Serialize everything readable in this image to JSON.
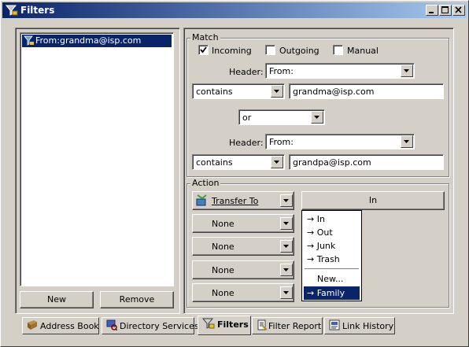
{
  "window": {
    "title": "Filters"
  },
  "filters": {
    "items": [
      {
        "label": "From:grandma@isp.com"
      }
    ]
  },
  "buttons": {
    "new": "New",
    "remove": "Remove"
  },
  "match": {
    "group_title": "Match",
    "incoming": {
      "label": "Incoming",
      "checked": true
    },
    "outgoing": {
      "label": "Outgoing",
      "checked": false
    },
    "manual": {
      "label": "Manual",
      "checked": false
    },
    "header_label": "Header:",
    "header1": "From:",
    "condition1": "contains",
    "value1": "grandma@isp.com",
    "conjunction": "or",
    "header2": "From:",
    "condition2": "contains",
    "value2": "grandpa@isp.com"
  },
  "action": {
    "group_title": "Action",
    "action1": "Transfer To",
    "action2": "None",
    "action3": "None",
    "action4": "None",
    "action5": "None",
    "mailbox_button": "In"
  },
  "mailbox_menu": {
    "items": [
      "→ In",
      "→ Out",
      "→ Junk",
      "→ Trash"
    ],
    "new_item": "New...",
    "selected_item": "→ Family"
  },
  "tabs": [
    {
      "label": "Address Book"
    },
    {
      "label": "Directory Services"
    },
    {
      "label": "Filters",
      "active": true
    },
    {
      "label": "Filter Report"
    },
    {
      "label": "Link History"
    }
  ],
  "colors": {
    "titlebar": "#0a246a",
    "selection": "#0a246a",
    "face": "#d4d0c8"
  }
}
